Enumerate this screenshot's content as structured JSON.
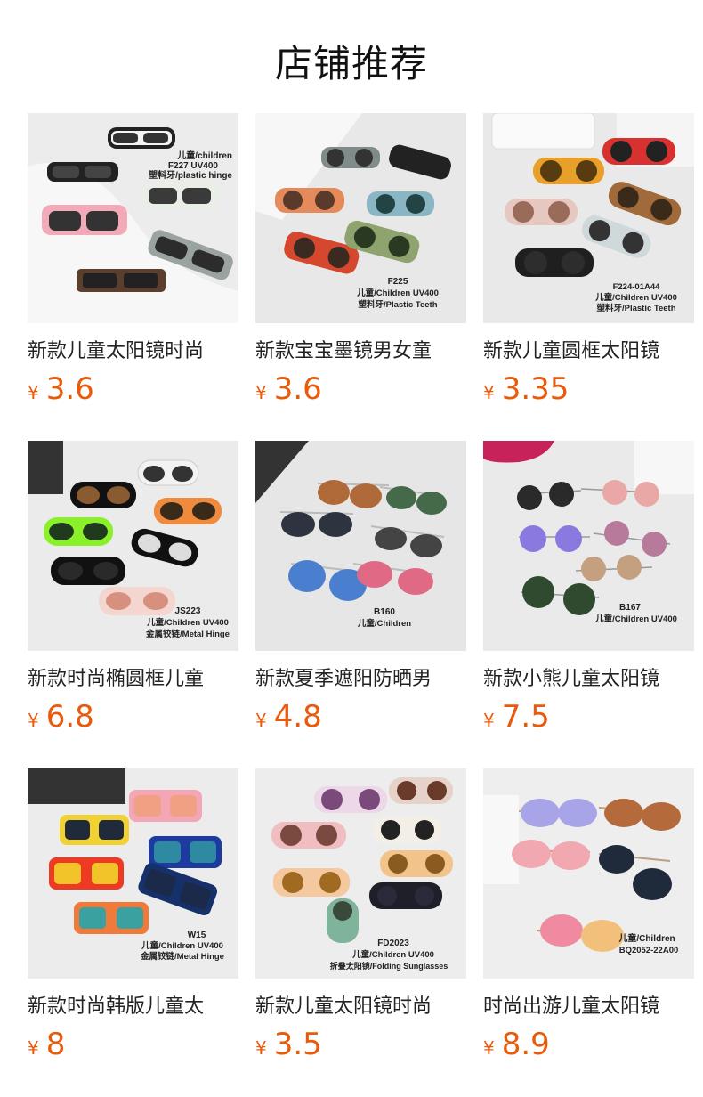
{
  "title": "店铺推荐",
  "products": [
    {
      "name": "新款儿童太阳镜时尚",
      "price": "3.6",
      "image_caption": [
        "儿童/children",
        "F227  UV400",
        "塑料牙/plastic hinge"
      ]
    },
    {
      "name": "新款宝宝墨镜男女童",
      "price": "3.6",
      "image_caption": [
        "F225",
        "儿童/Children UV400",
        "塑料牙/Plastic Teeth"
      ]
    },
    {
      "name": "新款儿童圆框太阳镜",
      "price": "3.35",
      "image_caption": [
        "F224-01A44",
        "儿童/Children UV400",
        "塑料牙/Plastic Teeth"
      ]
    },
    {
      "name": "新款时尚椭圆框儿童",
      "price": "6.8",
      "image_caption": [
        "JS223",
        "儿童/Children UV400",
        "金属铰链/Metal Hinge"
      ]
    },
    {
      "name": "新款夏季遮阳防晒男",
      "price": "4.8",
      "image_caption": [
        "B160",
        "儿童/Children"
      ]
    },
    {
      "name": "新款小熊儿童太阳镜",
      "price": "7.5",
      "image_caption": [
        "B167",
        "儿童/Children UV400"
      ]
    },
    {
      "name": "新款时尚韩版儿童太",
      "price": "8",
      "image_caption": [
        "W15",
        "儿童/Children UV400",
        "金属铰链/Metal Hinge"
      ]
    },
    {
      "name": "新款儿童太阳镜时尚",
      "price": "3.5",
      "image_caption": [
        "FD2023",
        "儿童/Children UV400",
        "折叠太阳镜/Folding Sunglasses"
      ]
    },
    {
      "name": "时尚出游儿童太阳镜",
      "price": "8.9",
      "image_caption": [
        "儿童/Children",
        "BQ2052-22A00"
      ]
    }
  ],
  "currency_symbol": "¥",
  "colors": {
    "price": "#e85a0c",
    "title": "#111111"
  }
}
